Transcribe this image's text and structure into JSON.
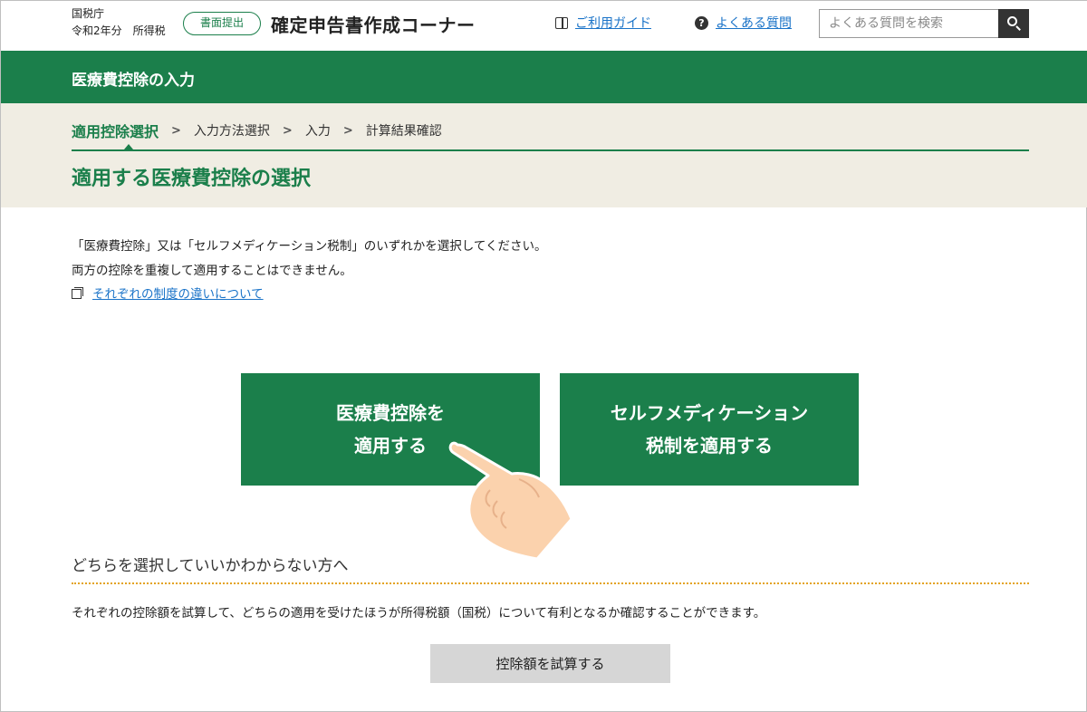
{
  "header": {
    "agency": "国税庁",
    "tax_year": "令和2年分　所得税",
    "submit_badge": "書面提出",
    "app_title": "確定申告書作成コーナー",
    "guide_link": "ご利用ガイド",
    "faq_link": "よくある質問",
    "search_placeholder": "よくある質問を検索",
    "icons": {
      "guide": "book-icon",
      "faq": "question-circle-icon",
      "search": "search-icon"
    }
  },
  "section": {
    "title": "医療費控除の入力"
  },
  "steps": {
    "items": [
      "適用控除選択",
      "入力方法選択",
      "入力",
      "計算結果確認"
    ],
    "current_index": 0
  },
  "page_title": "適用する医療費控除の選択",
  "intro": {
    "line1": "「医療費控除」又は「セルフメディケーション税制」のいずれかを選択してください。",
    "line2": "両方の控除を重複して適用することはできません。",
    "diff_link": "それぞれの制度の違いについて"
  },
  "choices": {
    "medical": {
      "line1": "医療費控除を",
      "line2": "適用する"
    },
    "self_medication": {
      "line1": "セルフメディケーション",
      "line2": "税制を適用する"
    }
  },
  "unsure": {
    "title": "どちらを選択していいかわからない方へ",
    "text": "それぞれの控除額を試算して、どちらの適用を受けたほうが所得税額（国税）について有利となるか確認することができます。",
    "button": "控除額を試算する"
  },
  "colors": {
    "brand_green": "#1b7f4b",
    "beige": "#f0ede3",
    "link_blue": "#1a73c8",
    "dotted_orange": "#e3a321"
  }
}
